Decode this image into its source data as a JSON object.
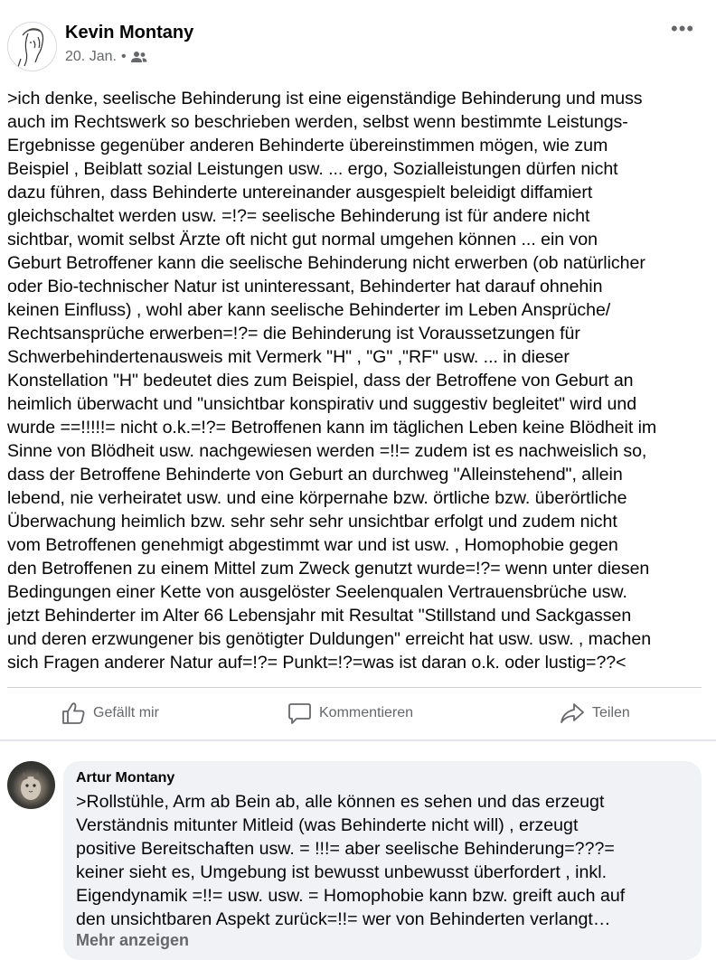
{
  "post": {
    "author": "Kevin Montany",
    "date": "20. Jan.",
    "separator": "•",
    "audience_icon": "friends-icon",
    "more_label": "•••",
    "body": ">ich denke, seelische Behinderung ist eine eigenständige Behinderung und muss\nauch im Rechtswerk so beschrieben werden, selbst wenn bestimmte Leistungs-\nErgebnisse gegenüber anderen Behinderte  übereinstimmen mögen, wie zum\nBeispiel , Beiblatt sozial Leistungen usw. ... ergo, Sozialleistungen dürfen nicht\ndazu führen, dass Behinderte untereinander ausgespielt beleidigt diffamiert\ngleichschaltet werden usw. =!?= seelische Behinderung ist für andere nicht\nsichtbar, womit selbst Ärzte oft nicht gut normal umgehen können ...  ein von\nGeburt Betroffener kann die seelische Behinderung nicht erwerben (ob natürlicher\noder Bio-technischer Natur ist uninteressant, Behinderter hat  darauf ohnehin\nkeinen Einfluss) , wohl aber kann seelische Behinderter im Leben Ansprüche/\nRechtsansprüche erwerben=!?= die Behinderung  ist Voraussetzungen für\nSchwerbehindertenausweis mit Vermerk \"H\" , \"G\" ,\"RF\" usw. ... in dieser\nKonstellation \"H\"   bedeutet dies zum Beispiel, dass der Betroffene von Geburt an\nheimlich überwacht und \"unsichtbar konspirativ und suggestiv begleitet\"  wird und\nwurde ==!!!!!= nicht o.k.=!?= Betroffenen kann im täglichen Leben keine Blödheit im\nSinne von Blödheit usw. nachgewiesen werden =!!= zudem ist es nachweislich so,\ndass der Betroffene Behinderte von Geburt an durchweg \"Alleinstehend\", allein\nlebend, nie verheiratet usw.  und eine körpernahe bzw. örtliche bzw.  überörtliche\nÜberwachung heimlich bzw. sehr sehr sehr unsichtbar erfolgt und zudem nicht\nvom  Betroffenen genehmigt abgestimmt war und ist usw. , Homophobie gegen\nden Betroffenen zu einem Mittel zum Zweck genutzt wurde=!?= wenn unter diesen\nBedingungen einer Kette von ausgelöster Seelenqualen  Vertrauensbrüche usw.\njetzt Behinderter im Alter  66 Lebensjahr  mit Resultat \"Stillstand  und Sackgassen\nund deren erzwungener bis genötigter Duldungen\" erreicht hat usw. usw. , machen\nsich Fragen anderer Natur auf=!?= Punkt=!?=was ist daran o.k. oder lustig=??<"
  },
  "actions": {
    "like_label": "Gefällt mir",
    "comment_label": "Kommentieren",
    "share_label": "Teilen"
  },
  "comment": {
    "author": "Artur Montany",
    "text": ">Rollstühle, Arm ab Bein ab, alle können es sehen und das erzeugt\nVerständnis mitunter Mitleid (was Behinderte nicht will) , erzeugt\npositive Bereitschaften usw. = !!!= aber seelische Behinderung=???=\nkeiner sieht es, Umgebung ist bewusst unbewusst  überfordert , inkl.\nEigendynamik =!!= usw. usw. = Homophobie kann bzw. greift auch auf\nden unsichtbaren Aspekt zurück=!!= wer von Behinderten verlangt…",
    "see_more": "Mehr anzeigen"
  },
  "colors": {
    "text_primary": "#050505",
    "text_secondary": "#65676b",
    "divider": "#ced0d4",
    "bubble": "#f0f2f5"
  }
}
